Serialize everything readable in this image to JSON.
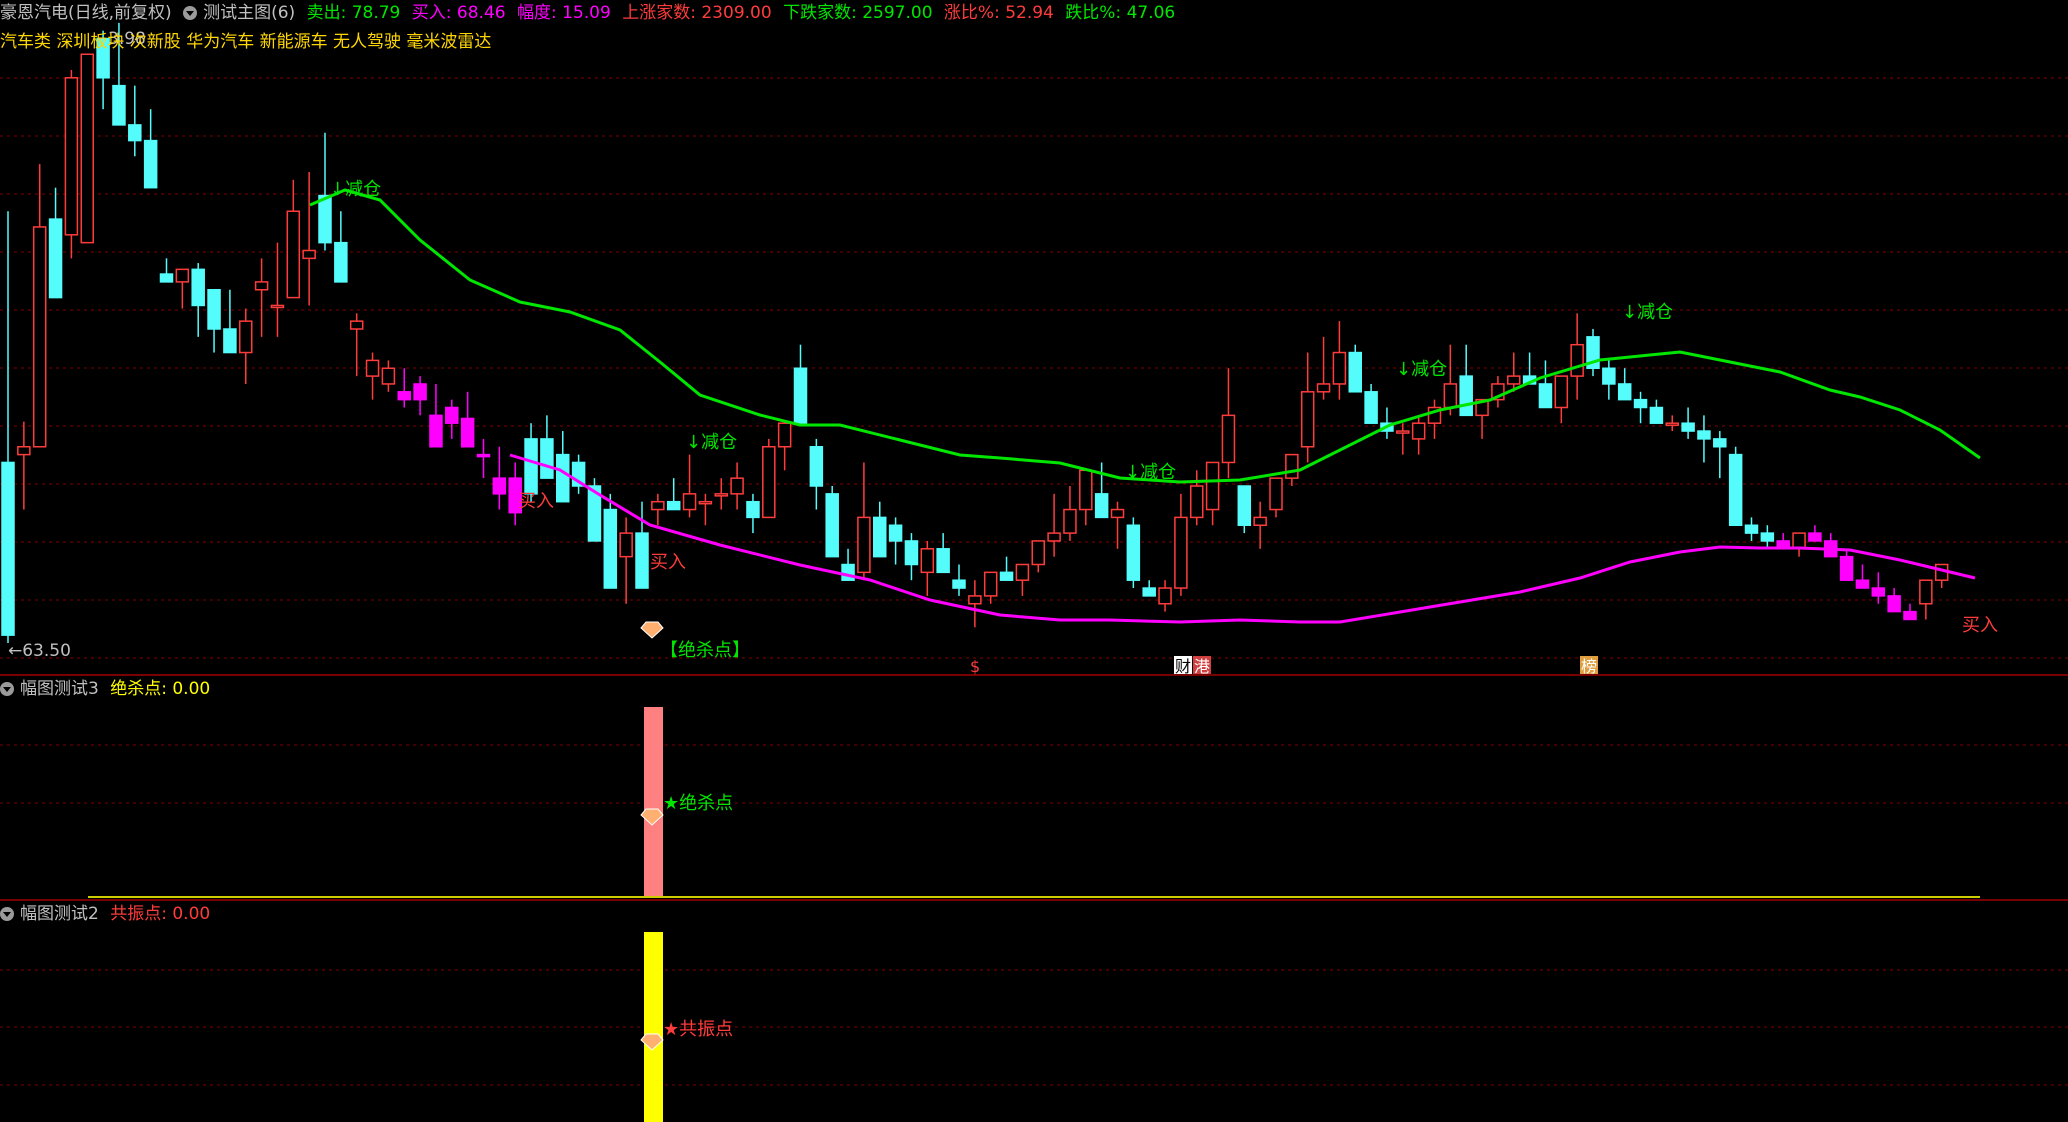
{
  "header": {
    "stock": "豪恩汽电(日线,前复权)",
    "indicator": "测试主图(6)",
    "sell": "卖出: 78.79",
    "buy": "买入: 68.46",
    "amplitude": "幅度: 15.09",
    "up_count": "上涨家数: 2309.00",
    "down_count": "下跌家数: 2597.00",
    "up_ratio": "涨比%: 52.94",
    "down_ratio": "跌比%: 47.06",
    "concepts": "汽车类 深圳板块 次新股 华为汽车 新能源车 无人驾驶 毫米波雷达"
  },
  "panel2": {
    "title": "幅图测试3",
    "value": "绝杀点: 0.00",
    "star_label": "★绝杀点"
  },
  "panel3": {
    "title": "幅图测试2",
    "value": "共振点: 0.00",
    "star_label": "★共振点"
  },
  "colors": {
    "up": "#ff3c3c",
    "down": "#54fcfc",
    "green_line": "#00e600",
    "magenta_line": "#ff00ff",
    "buy_candle": "#ff00ff",
    "lime_candle": "#00cc00",
    "yellow_candle": "#ffff00",
    "grid": "#800000",
    "panel_bar2": "#ff8080",
    "panel_bar3": "#ffff00"
  },
  "chart_data": {
    "type": "candlestick",
    "y_low_label": "63.50",
    "y_high_label": "3.98",
    "candles": [
      [
        75.0,
        91.0,
        63.5,
        64.0
      ],
      [
        75.5,
        77.6,
        72.0,
        76.0
      ],
      [
        76.0,
        94.0,
        76.0,
        90.0
      ],
      [
        90.5,
        92.5,
        86.0,
        85.5
      ],
      [
        89.5,
        100.0,
        88.0,
        99.5
      ],
      [
        89.0,
        100.3,
        89.0,
        101.0
      ],
      [
        102.0,
        102.5,
        97.5,
        99.5
      ],
      [
        99.0,
        103.0,
        99.0,
        96.5
      ],
      [
        96.5,
        99.0,
        94.5,
        95.5
      ],
      [
        95.5,
        97.5,
        93.5,
        92.5
      ],
      [
        87.0,
        88.0,
        86.5,
        86.5
      ],
      [
        86.5,
        87.3,
        84.8,
        87.3
      ],
      [
        87.3,
        87.7,
        83.0,
        85.0
      ],
      [
        86.0,
        85.3,
        82.0,
        83.5
      ],
      [
        83.5,
        86.0,
        83.5,
        82.0
      ],
      [
        82.0,
        84.8,
        80.0,
        84.0
      ],
      [
        86.0,
        88.0,
        83.0,
        86.5
      ],
      [
        85.0,
        89.0,
        83.0,
        85.0
      ],
      [
        85.5,
        93.0,
        85.5,
        91.0
      ],
      [
        88.0,
        93.5,
        85.0,
        88.5
      ],
      [
        92.0,
        96.0,
        88.5,
        89.0
      ],
      [
        89.0,
        91.0,
        87.0,
        86.5
      ],
      [
        83.5,
        84.5,
        80.5,
        84.0
      ],
      [
        80.5,
        82.0,
        79.0,
        81.5
      ],
      [
        80.0,
        81.5,
        79.5,
        81.0
      ],
      [
        79.5,
        81.0,
        78.5,
        79.0
      ],
      [
        79.0,
        80.5,
        78.0,
        80.0
      ],
      [
        78.0,
        80.0,
        77.5,
        76.0
      ],
      [
        77.5,
        79.0,
        76.5,
        78.5
      ],
      [
        77.8,
        79.5,
        76.0,
        76.0
      ],
      [
        75.5,
        76.5,
        74.0,
        75.5
      ],
      [
        74.0,
        76.0,
        72.0,
        73.0
      ],
      [
        71.8,
        75.0,
        71.0,
        74.0
      ],
      [
        76.5,
        77.5,
        72.5,
        73.0
      ],
      [
        76.5,
        78.0,
        75.5,
        74.0
      ],
      [
        75.5,
        77.0,
        74.5,
        72.5
      ],
      [
        75.0,
        75.5,
        73.0,
        73.5
      ],
      [
        73.5,
        74.0,
        71.5,
        70.0
      ],
      [
        72.0,
        73.0,
        69.0,
        67.0
      ],
      [
        69.0,
        71.5,
        66.0,
        70.5
      ],
      [
        70.5,
        72.5,
        70.5,
        67.0
      ],
      [
        72.0,
        73.0,
        71.0,
        72.5
      ],
      [
        72.5,
        74.0,
        72.0,
        72.0
      ],
      [
        72.0,
        75.5,
        71.5,
        73.0
      ],
      [
        72.5,
        73.0,
        71.0,
        72.5
      ],
      [
        73.0,
        74.0,
        72.0,
        73.0
      ],
      [
        73.0,
        75.0,
        72.0,
        74.0
      ],
      [
        72.5,
        73.0,
        70.5,
        71.5
      ],
      [
        71.5,
        76.5,
        71.5,
        76.0
      ],
      [
        76.0,
        77.0,
        74.5,
        77.5
      ],
      [
        81.0,
        82.5,
        77.5,
        77.5
      ],
      [
        76.0,
        76.5,
        72.0,
        73.5
      ],
      [
        73.0,
        73.5,
        71.0,
        69.0
      ],
      [
        68.5,
        69.5,
        67.5,
        67.5
      ],
      [
        68.0,
        75.0,
        67.5,
        71.5
      ],
      [
        71.5,
        72.5,
        69.0,
        69.0
      ],
      [
        71.0,
        71.5,
        68.5,
        70.0
      ],
      [
        70.0,
        70.5,
        67.5,
        68.5
      ],
      [
        68.0,
        70.0,
        66.5,
        69.5
      ],
      [
        69.5,
        70.5,
        68.5,
        68.0
      ],
      [
        67.5,
        68.5,
        66.5,
        67.0
      ],
      [
        66.0,
        67.5,
        64.5,
        66.5
      ],
      [
        66.5,
        67.5,
        66.0,
        68.0
      ],
      [
        68.0,
        69.0,
        67.5,
        67.5
      ],
      [
        67.5,
        68.5,
        66.5,
        68.5
      ],
      [
        68.5,
        69.5,
        68.0,
        70.0
      ],
      [
        70.0,
        73.0,
        69.0,
        70.5
      ],
      [
        70.5,
        73.5,
        70.0,
        72.0
      ],
      [
        72.0,
        74.0,
        71.0,
        74.5
      ],
      [
        73.0,
        75.0,
        71.5,
        71.5
      ],
      [
        71.5,
        72.5,
        69.5,
        72.0
      ],
      [
        71.0,
        71.5,
        67.0,
        67.5
      ],
      [
        67.0,
        67.5,
        66.5,
        66.5
      ],
      [
        66.0,
        67.5,
        65.5,
        67.0
      ],
      [
        67.0,
        73.0,
        66.5,
        71.5
      ],
      [
        71.5,
        74.5,
        71.0,
        73.5
      ],
      [
        72.0,
        75.0,
        71.0,
        75.0
      ],
      [
        75.0,
        81.0,
        74.0,
        78.0
      ],
      [
        73.5,
        73.0,
        70.5,
        71.0
      ],
      [
        71.0,
        72.5,
        69.5,
        71.5
      ],
      [
        72.0,
        73.5,
        71.5,
        74.0
      ],
      [
        74.0,
        74.5,
        73.5,
        75.5
      ],
      [
        76.0,
        82.0,
        75.0,
        79.5
      ],
      [
        79.5,
        83.0,
        79.0,
        80.0
      ],
      [
        80.0,
        84.0,
        79.0,
        82.0
      ],
      [
        82.0,
        82.5,
        80.0,
        79.5
      ],
      [
        79.5,
        80.0,
        77.5,
        77.5
      ],
      [
        77.5,
        78.5,
        76.5,
        77.0
      ],
      [
        77.0,
        77.5,
        75.5,
        77.0
      ],
      [
        76.5,
        78.0,
        75.5,
        77.5
      ],
      [
        77.5,
        79.0,
        76.5,
        78.5
      ],
      [
        78.5,
        82.5,
        78.0,
        80.0
      ],
      [
        80.5,
        82.5,
        80.0,
        78.0
      ],
      [
        78.0,
        79.0,
        76.5,
        79.0
      ],
      [
        79.0,
        80.5,
        78.5,
        80.0
      ],
      [
        80.0,
        82.0,
        79.5,
        80.5
      ],
      [
        80.5,
        82.0,
        80.0,
        80.0
      ],
      [
        80.0,
        81.5,
        79.0,
        78.5
      ],
      [
        78.5,
        80.5,
        77.5,
        80.5
      ],
      [
        80.5,
        84.5,
        79.0,
        82.5
      ],
      [
        83.0,
        83.5,
        80.5,
        81.0
      ],
      [
        81.0,
        81.5,
        79.0,
        80.0
      ],
      [
        80.0,
        81.0,
        79.5,
        79.0
      ],
      [
        79.0,
        79.5,
        77.5,
        78.5
      ],
      [
        78.5,
        79.0,
        78.0,
        77.5
      ],
      [
        77.5,
        78.0,
        77.0,
        77.5
      ],
      [
        77.5,
        78.5,
        76.5,
        77.0
      ],
      [
        77.0,
        78.0,
        75.0,
        76.5
      ],
      [
        76.5,
        77.0,
        74.0,
        76.0
      ],
      [
        75.5,
        76.0,
        71.0,
        71.0
      ],
      [
        71.0,
        71.5,
        70.0,
        70.5
      ],
      [
        70.5,
        71.0,
        69.5,
        70.0
      ],
      [
        70.0,
        70.5,
        69.5,
        69.5
      ],
      [
        69.5,
        70.0,
        69.0,
        70.5
      ],
      [
        70.5,
        71.0,
        70.0,
        70.0
      ],
      [
        70.0,
        70.5,
        69.0,
        69.0
      ],
      [
        69.0,
        69.5,
        67.5,
        67.5
      ],
      [
        67.5,
        68.5,
        67.0,
        67.0
      ],
      [
        67.0,
        68.0,
        66.0,
        66.5
      ],
      [
        66.5,
        67.0,
        66.0,
        65.5
      ],
      [
        65.5,
        66.0,
        65.0,
        65.0
      ],
      [
        66.0,
        67.5,
        65.0,
        67.5
      ],
      [
        67.5,
        68.5,
        67.0,
        68.5
      ]
    ]
  },
  "labels": {
    "reduce": "↓减仓",
    "buy": "买入",
    "kill": "【绝杀点】",
    "dollar": "$",
    "cai": "财",
    "gang": "港",
    "bang": "榜"
  }
}
